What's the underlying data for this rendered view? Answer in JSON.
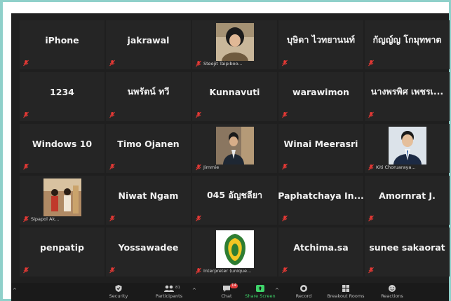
{
  "participants": [
    {
      "name": "iPhone",
      "type": "text"
    },
    {
      "name": "jakrawal",
      "type": "text"
    },
    {
      "name": "Steejit Taipiboo...",
      "type": "photo",
      "photo": "woman-portrait"
    },
    {
      "name": "บุษิดา ไวทยานนท์",
      "type": "text"
    },
    {
      "name": "กัญญ์ญ โกมุทพาต",
      "type": "text"
    },
    {
      "name": "1234",
      "type": "text"
    },
    {
      "name": "นพรัตน์ ทวี",
      "type": "text"
    },
    {
      "name": "Kunnavuti",
      "type": "text"
    },
    {
      "name": "warawimon",
      "type": "text"
    },
    {
      "name": "นางพรพิศ เพชรเ...",
      "type": "text"
    },
    {
      "name": "Windows 10",
      "type": "text"
    },
    {
      "name": "Timo Ojanen",
      "type": "text"
    },
    {
      "name": "Jimmie",
      "type": "photo",
      "photo": "man-portrait"
    },
    {
      "name": "Winai Meerasri",
      "type": "text"
    },
    {
      "name": "Kiti Choruaraya...",
      "type": "photo",
      "photo": "man-suit-portrait"
    },
    {
      "name": "Sipapol Ak...",
      "type": "photo",
      "photo": "people-photo"
    },
    {
      "name": "Niwat Ngam",
      "type": "text"
    },
    {
      "name": "045 อัญชลียา",
      "type": "text"
    },
    {
      "name": "Paphatchaya In...",
      "type": "text"
    },
    {
      "name": "Amornrat J.",
      "type": "text"
    },
    {
      "name": "penpatip",
      "type": "text"
    },
    {
      "name": "Yossawadee",
      "type": "text"
    },
    {
      "name": "Interpreter (unique...",
      "type": "photo",
      "photo": "emblem-logo"
    },
    {
      "name": "Atchima.sa",
      "type": "text"
    },
    {
      "name": "sunee sakaorat",
      "type": "text"
    }
  ],
  "toolbar": {
    "security": "Security",
    "participants": "Participants",
    "participants_count": "81",
    "chat": "Chat",
    "chat_badge": "14",
    "share": "Share Screen",
    "record": "Record",
    "breakout": "Breakout Rooms",
    "reactions": "Reactions"
  },
  "colors": {
    "background": "#1f1f1f",
    "tile": "#252525",
    "mute": "#e53935",
    "share_green": "#3fd46a",
    "border": "#8fd0ca"
  }
}
